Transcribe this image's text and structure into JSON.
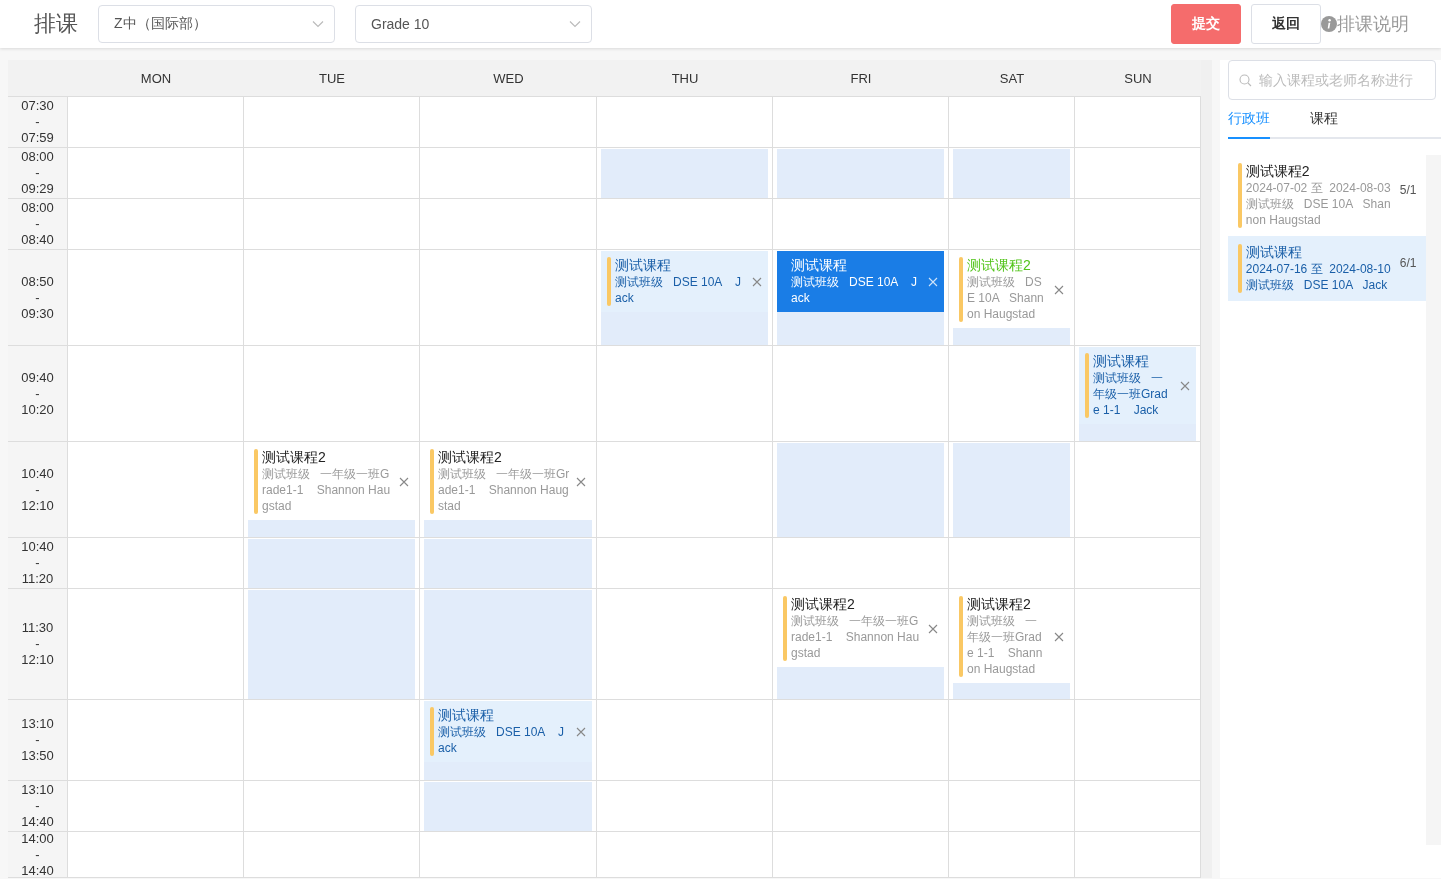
{
  "header": {
    "title": "排课",
    "selects": [
      {
        "value": "Z中（国际部）"
      },
      {
        "value": "Grade 10"
      }
    ],
    "buttons": [
      {
        "label": "提交",
        "kind": "primary"
      },
      {
        "label": "返回",
        "kind": "default"
      }
    ],
    "help": "排课说明"
  },
  "calendar": {
    "days": [
      "MON",
      "TUE",
      "WED",
      "THU",
      "FRI",
      "SAT",
      "SUN"
    ],
    "rows": [
      {
        "start": "07:30",
        "sep": "-",
        "end": "07:59",
        "cells": [
          {
            "available": false
          },
          {
            "available": false
          },
          {
            "available": false
          },
          {
            "available": false
          },
          {
            "available": false
          },
          {
            "available": false
          },
          {
            "available": false
          }
        ]
      },
      {
        "start": "08:00",
        "sep": "-",
        "end": "09:29",
        "cells": [
          {
            "available": false
          },
          {
            "available": false
          },
          {
            "available": false
          },
          {
            "available": true
          },
          {
            "available": true
          },
          {
            "available": true
          },
          {
            "available": false
          }
        ]
      },
      {
        "start": "08:00",
        "sep": "-",
        "end": "08:40",
        "cells": [
          {
            "available": false
          },
          {
            "available": false
          },
          {
            "available": false
          },
          {
            "available": false
          },
          {
            "available": false
          },
          {
            "available": false
          },
          {
            "available": false
          }
        ]
      },
      {
        "start": "08:50",
        "sep": "-",
        "end": "09:30",
        "cells": [
          {
            "available": false
          },
          {
            "available": false
          },
          {
            "available": false
          },
          {
            "available": true,
            "lesson": {
              "title": "测试课程",
              "detail": "测试班级   DSE 10A    Jack",
              "kind": "linked",
              "selected": false
            }
          },
          {
            "available": true,
            "lesson": {
              "title": "测试课程",
              "detail": "测试班级   DSE 10A    Jack",
              "kind": "linked",
              "selected": true
            }
          },
          {
            "available": true,
            "lesson": {
              "title": "测试课程2",
              "detail": "测试班级   DSE 10A   Shannon Haugstad",
              "kind": "new",
              "selected": false
            }
          },
          {
            "available": false
          }
        ]
      },
      {
        "start": "09:40",
        "sep": "-",
        "end": "10:20",
        "cells": [
          {
            "available": false
          },
          {
            "available": false
          },
          {
            "available": false
          },
          {
            "available": false
          },
          {
            "available": false
          },
          {
            "available": false
          },
          {
            "available": true,
            "lesson": {
              "title": "测试课程",
              "detail": "测试班级   一年级一班Grade 1-1    Jack",
              "kind": "linked",
              "selected": false
            }
          }
        ]
      },
      {
        "start": "10:40",
        "sep": "-",
        "end": "12:10",
        "cells": [
          {
            "available": false
          },
          {
            "available": true,
            "lesson": {
              "title": "测试课程2",
              "detail": "测试班级   一年级一班Grade1-1    Shannon Haugstad",
              "kind": "plain",
              "selected": false
            }
          },
          {
            "available": true,
            "lesson": {
              "title": "测试课程2",
              "detail": "测试班级   一年级一班Grade1-1    Shannon Haugstad",
              "kind": "plain",
              "selected": false
            }
          },
          {
            "available": false
          },
          {
            "available": true
          },
          {
            "available": true
          },
          {
            "available": false
          }
        ]
      },
      {
        "start": "10:40",
        "sep": "-",
        "end": "11:20",
        "cells": [
          {
            "available": false
          },
          {
            "available": true
          },
          {
            "available": true
          },
          {
            "available": false
          },
          {
            "available": false
          },
          {
            "available": false
          },
          {
            "available": false
          }
        ]
      },
      {
        "start": "11:30",
        "sep": "-",
        "end": "12:10",
        "cells": [
          {
            "available": false
          },
          {
            "available": true
          },
          {
            "available": true
          },
          {
            "available": false
          },
          {
            "available": true,
            "lesson": {
              "title": "测试课程2",
              "detail": "测试班级   一年级一班Grade1-1    Shannon Haugstad",
              "kind": "plain",
              "selected": false
            }
          },
          {
            "available": true,
            "lesson": {
              "title": "测试课程2",
              "detail": "测试班级   一年级一班Grade 1-1    Shannon Haugstad",
              "kind": "plain",
              "selected": false
            }
          },
          {
            "available": false
          }
        ]
      },
      {
        "start": "13:10",
        "sep": "-",
        "end": "13:50",
        "cells": [
          {
            "available": false
          },
          {
            "available": false
          },
          {
            "available": true,
            "lesson": {
              "title": "测试课程",
              "detail": "测试班级   DSE 10A    Jack",
              "kind": "linked",
              "selected": false
            }
          },
          {
            "available": false
          },
          {
            "available": false
          },
          {
            "available": false
          },
          {
            "available": false
          }
        ]
      },
      {
        "start": "13:10",
        "sep": "-",
        "end": "14:40",
        "cells": [
          {
            "available": false
          },
          {
            "available": false
          },
          {
            "available": true
          },
          {
            "available": false
          },
          {
            "available": false
          },
          {
            "available": false
          },
          {
            "available": false
          }
        ]
      },
      {
        "start": "14:00",
        "sep": "-",
        "end": "14:40",
        "cells": [
          {
            "available": false
          },
          {
            "available": false
          },
          {
            "available": false
          },
          {
            "available": false
          },
          {
            "available": false
          },
          {
            "available": false
          },
          {
            "available": false
          }
        ]
      }
    ]
  },
  "sidebar": {
    "search": {
      "placeholder": "输入课程或老师名称进行"
    },
    "tabs": [
      {
        "label": "行政班",
        "selected": true
      },
      {
        "label": "课程",
        "selected": false
      }
    ],
    "items": [
      {
        "title": "测试课程2",
        "dates": "2024-07-02 至  2024-08-03",
        "detail": "测试班级   DSE 10A   Shannon Haugstad",
        "count": "5/1",
        "selected": false
      },
      {
        "title": "测试课程",
        "dates": "2024-07-16 至  2024-08-10",
        "detail": "测试班级   DSE 10A   Jack",
        "count": "6/1",
        "selected": true
      }
    ]
  }
}
